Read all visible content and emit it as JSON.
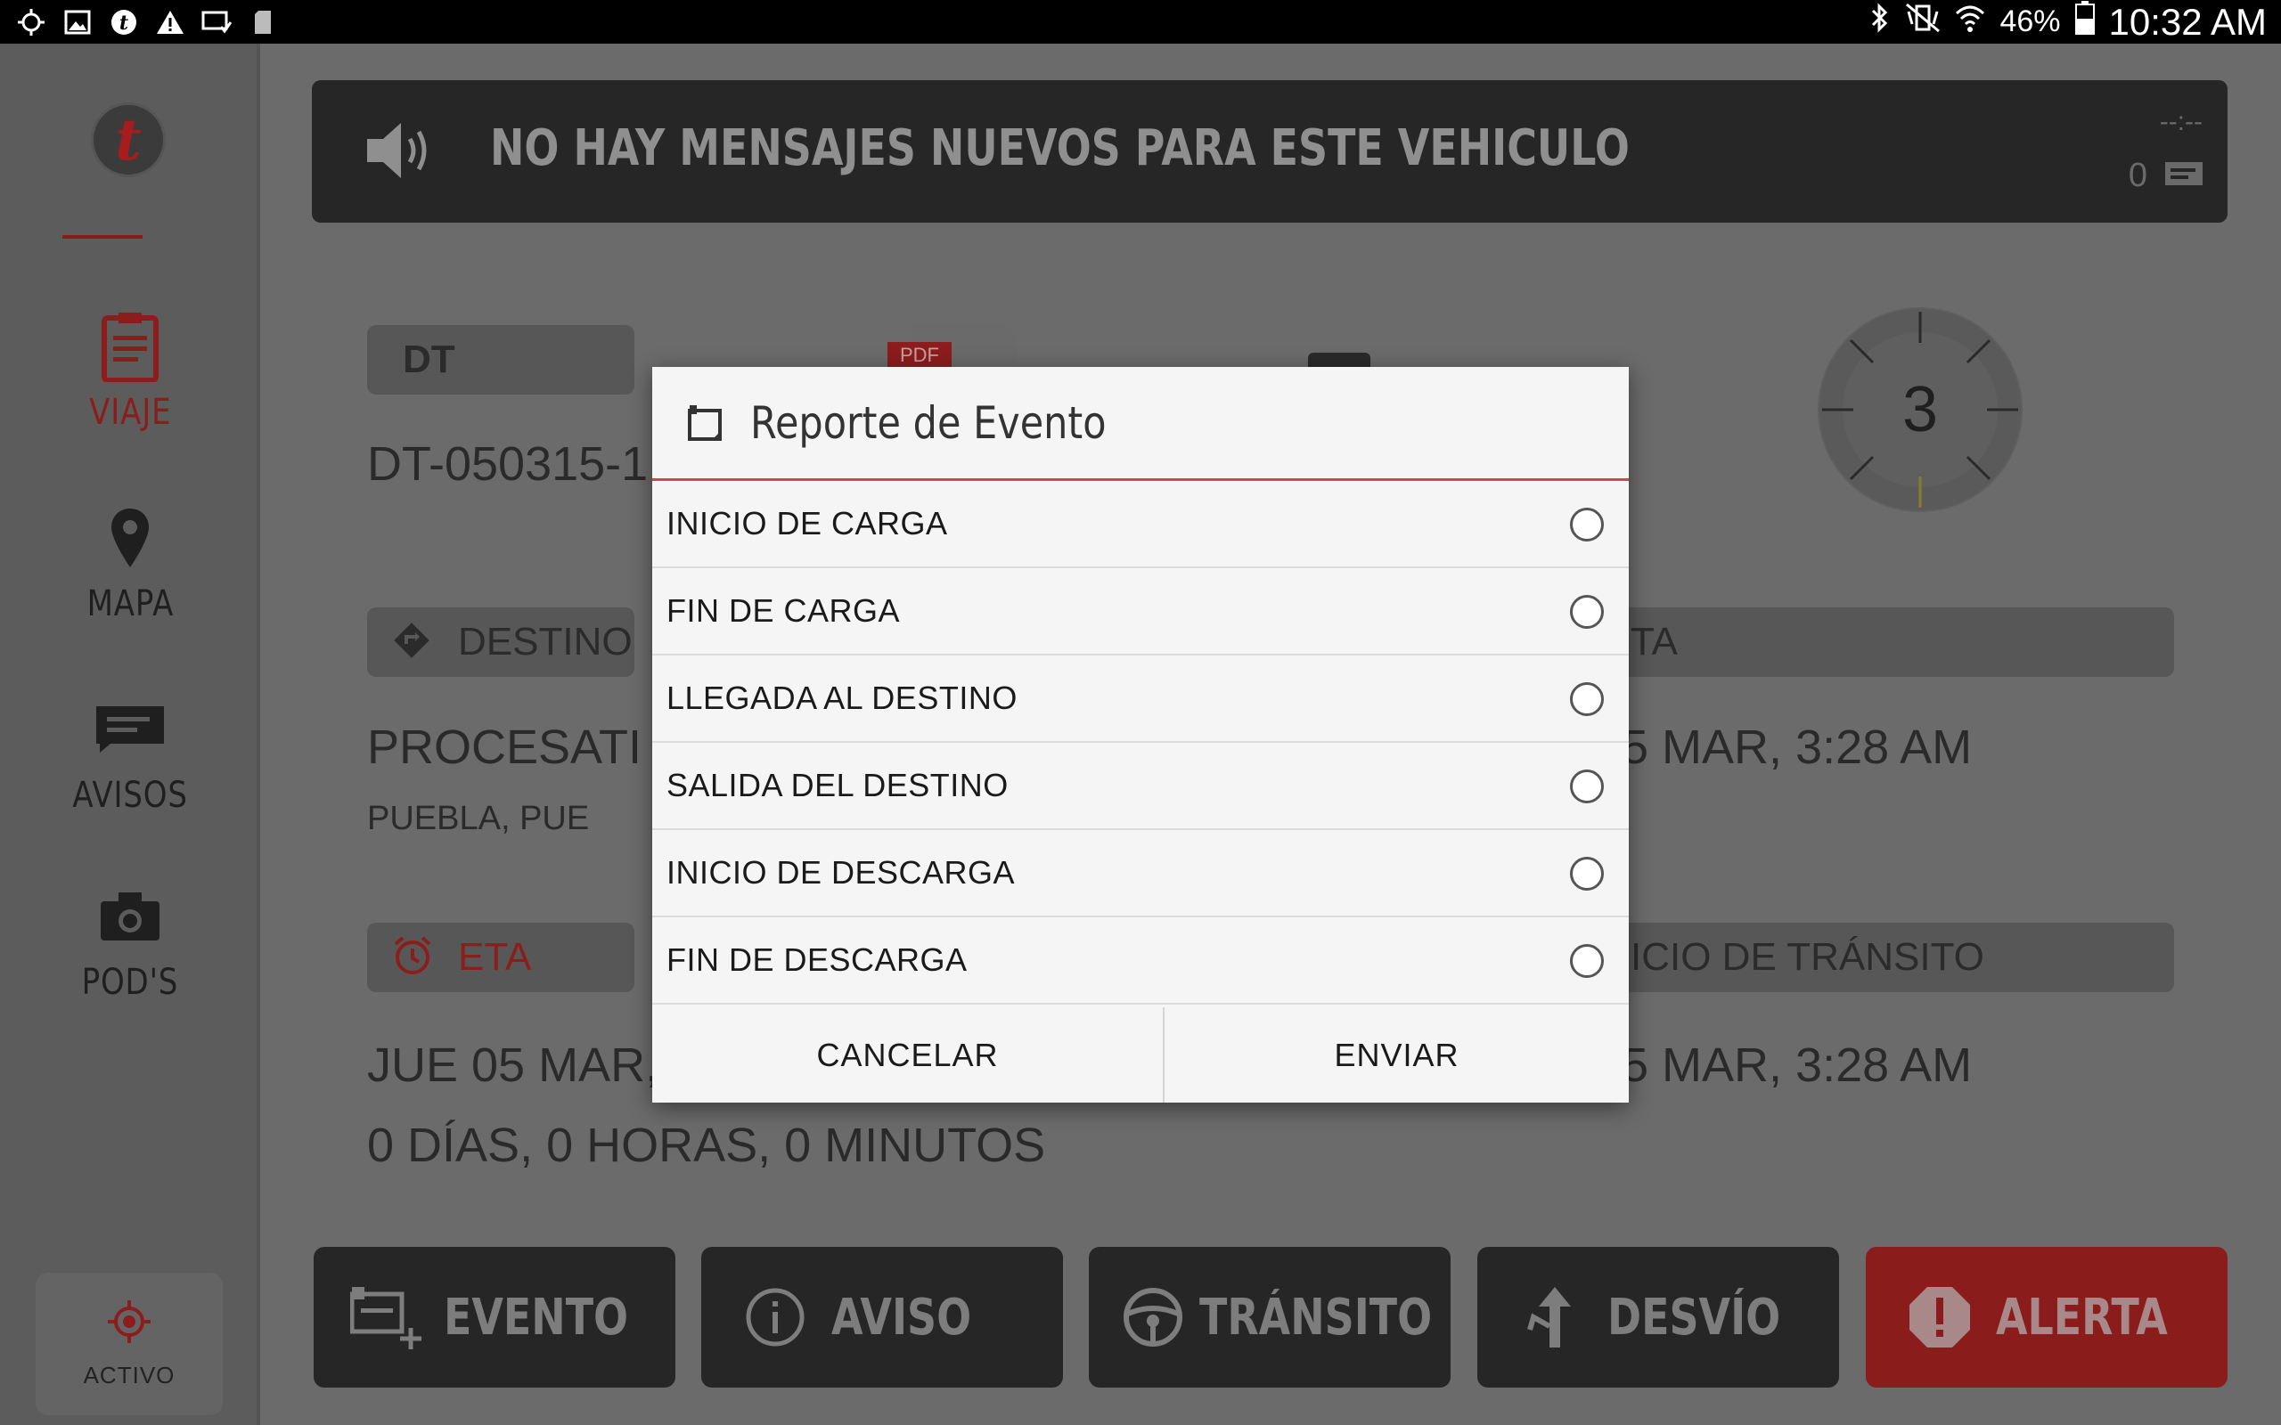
{
  "status_bar": {
    "battery": "46%",
    "time": "10:32 AM"
  },
  "sidebar": {
    "logo_letter": "t",
    "items": [
      {
        "label": "VIAJE",
        "icon": "clipboard-icon"
      },
      {
        "label": "MAPA",
        "icon": "map-pin-icon"
      },
      {
        "label": "AVISOS",
        "icon": "message-icon"
      },
      {
        "label": "POD'S",
        "icon": "camera-icon"
      }
    ],
    "status_label": "ACTIVO"
  },
  "banner": {
    "message": "NO HAY MENSAJES NUEVOS PARA ESTE VEHICULO",
    "time": "--:--",
    "count": "0"
  },
  "trip": {
    "dt_label": "DT",
    "dt_value": "DT-050315-1",
    "pdf_label": "PDF",
    "counter": "3",
    "destino_label": "DESTINO",
    "destino_name": "PROCESATI",
    "destino_city": "PUEBLA, PUE",
    "right_top_label": "TA",
    "right_top_value": "5 MAR, 3:28 AM",
    "eta_label": "ETA",
    "eta_value": "JUE 05 MAR,",
    "eta_remaining": "0 DÍAS, 0 HORAS, 0 MINUTOS",
    "right_bottom_label": "ICIO DE TRÁNSITO",
    "right_bottom_value": "5 MAR, 3:28 AM"
  },
  "actions": [
    {
      "label": "EVENTO",
      "icon": "event-add-icon"
    },
    {
      "label": "AVISO",
      "icon": "info-icon"
    },
    {
      "label": "TRÁNSITO",
      "icon": "steering-wheel-icon"
    },
    {
      "label": "DESVÍO",
      "icon": "detour-icon"
    },
    {
      "label": "ALERTA",
      "icon": "alert-icon"
    }
  ],
  "dialog": {
    "title": "Reporte de Evento",
    "options": [
      "INICIO DE CARGA",
      "FIN DE CARGA",
      "LLEGADA AL DESTINO",
      "SALIDA DEL DESTINO",
      "INICIO DE DESCARGA",
      "FIN DE DESCARGA"
    ],
    "cancel_label": "CANCELAR",
    "send_label": "ENVIAR"
  },
  "colors": {
    "accent_red": "#8a1c1c",
    "dialog_divider": "#d64646",
    "panel_dark": "#262626"
  }
}
